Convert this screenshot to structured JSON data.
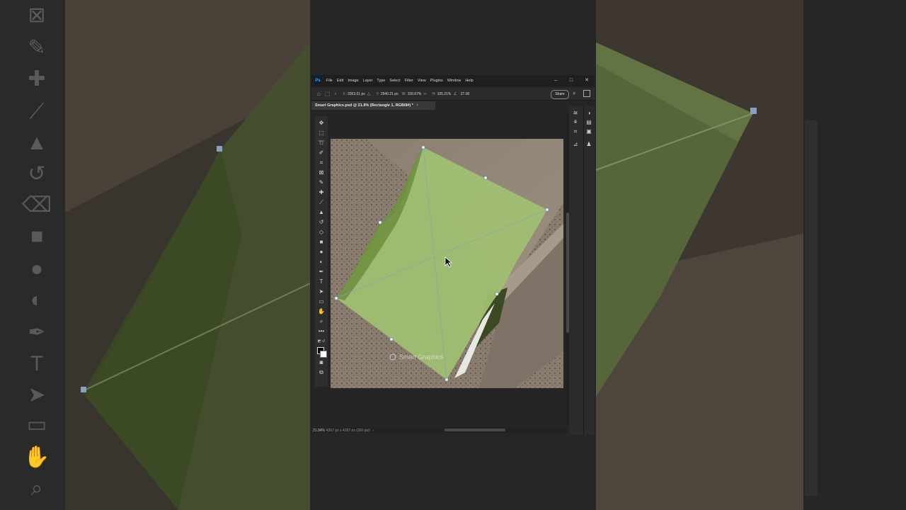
{
  "menubar": {
    "logo": "Ps",
    "items": [
      "File",
      "Edit",
      "Image",
      "Layer",
      "Type",
      "Select",
      "Filter",
      "View",
      "Plugins",
      "Window",
      "Help"
    ]
  },
  "window_controls": {
    "minimize": "–",
    "maximize": "□",
    "close": "✕"
  },
  "options_bar": {
    "x_label": "X:",
    "x_value": "2053.01 px",
    "y_label": "Y:",
    "y_value": "2940.21 px",
    "w_label": "W:",
    "w_value": "109.67%",
    "h_label": "H:",
    "h_value": "105.21%",
    "angle_value": "27.00",
    "share_label": "Share"
  },
  "document_tab": {
    "title": "Smart Graphics.psd @ 21.9% (Rectangle 1, RGB/8#) *",
    "close": "×"
  },
  "watermark": "Smart Graphics",
  "status": {
    "zoom": "21.94%",
    "doc_size": "4267 px x 4267 px (300 ppi)"
  },
  "tools": [
    "move-icon",
    "marquee-icon",
    "lasso-icon",
    "quick-select-icon",
    "crop-icon",
    "frame-icon",
    "eyedropper-icon",
    "healing-icon",
    "brush-icon",
    "stamp-icon",
    "history-brush-icon",
    "eraser-icon",
    "gradient-icon",
    "blur-icon",
    "dodge-icon",
    "pen-icon",
    "type-icon",
    "path-select-icon",
    "rectangle-icon",
    "hand-icon",
    "zoom-icon",
    "more-icon"
  ],
  "colors": {
    "shape_fill": "#9fbf72",
    "shape_edge": "#5f8a3a",
    "accent": "#31a8ff"
  }
}
